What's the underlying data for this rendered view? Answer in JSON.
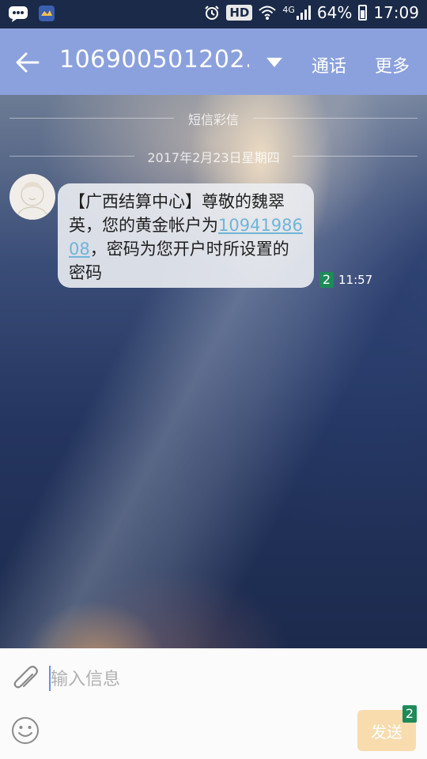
{
  "status_bar": {
    "hd": "HD",
    "network": "4G",
    "battery": "64%",
    "time": "17:09",
    "icons": [
      "message-notification-icon",
      "app-notification-icon",
      "alarm-icon",
      "wifi-icon",
      "signal-icon",
      "battery-icon"
    ]
  },
  "header": {
    "contact": "106900501202...",
    "call": "通话",
    "more": "更多"
  },
  "conversation": {
    "section_label": "短信彩信",
    "date_label": "2017年2月23日星期四",
    "message": {
      "text_before": "【广西结算中心】尊敬的魏翠英，您的黄金帐户为",
      "link": "1094198608",
      "text_after": "，密码为您开户时所设置的密码",
      "sim": "2",
      "time": "11:57"
    }
  },
  "compose": {
    "placeholder": "输入信息",
    "send": "发送",
    "send_sim": "2"
  },
  "colors": {
    "app_bar": "#8ba1dd",
    "status_bar": "#1a2a48",
    "send_button": "#f8dcae",
    "sim_badge": "#1e8a5a",
    "link": "#6fb5d8"
  }
}
